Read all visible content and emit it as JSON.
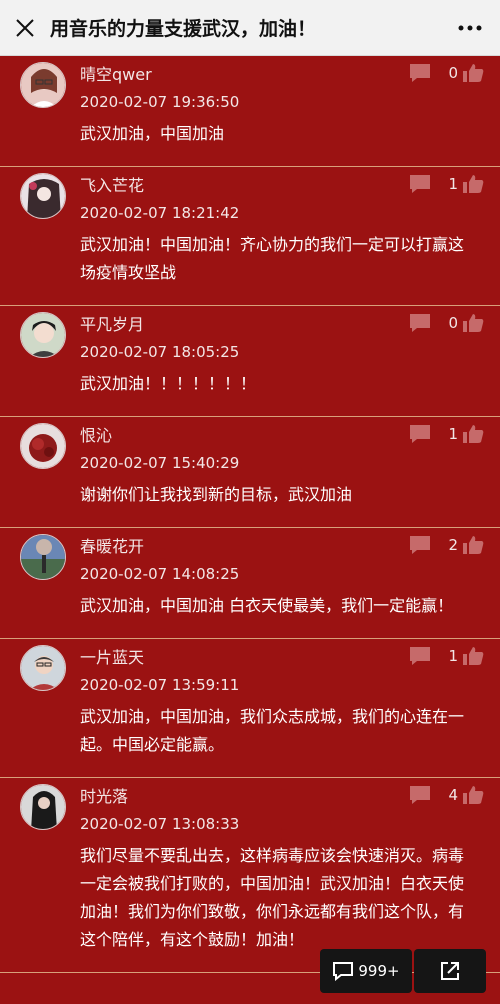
{
  "header": {
    "title": "用音乐的力量支援武汉，加油！"
  },
  "comments": [
    {
      "name": "晴空qwer",
      "time": "2020-02-07 19:36:50",
      "content": "武汉加油，中国加油",
      "likes": "0"
    },
    {
      "name": "飞入芒花",
      "time": "2020-02-07 18:21:42",
      "content": "武汉加油！中国加油！齐心协力的我们一定可以打赢这场疫情攻坚战",
      "likes": "1"
    },
    {
      "name": "平凡岁月",
      "time": "2020-02-07 18:05:25",
      "content": "武汉加油！！！！！！！",
      "likes": "0"
    },
    {
      "name": "恨沁",
      "time": "2020-02-07 15:40:29",
      "content": "谢谢你们让我找到新的目标，武汉加油",
      "likes": "1"
    },
    {
      "name": "春暖花开",
      "time": "2020-02-07 14:08:25",
      "content": "武汉加油，中国加油 白衣天使最美，我们一定能赢！",
      "likes": "2"
    },
    {
      "name": "一片蓝天",
      "time": "2020-02-07 13:59:11",
      "content": "武汉加油，中国加油，我们众志成城，我们的心连在一起。中国必定能赢。",
      "likes": "1"
    },
    {
      "name": "时光落",
      "time": "2020-02-07 13:08:33",
      "content": "我们尽量不要乱出去，这样病毒应该会快速消灭。病毒一定会被我们打败的，中国加油！武汉加油！白衣天使加油！我们为你们致敬，你们永远都有我们这个队，有这个陪伴，有这个鼓励！加油！",
      "likes": "4"
    }
  ],
  "float_bar": {
    "comment_count": "999+"
  },
  "colors": {
    "background": "#9b1212",
    "header": "#f2f2f2",
    "divider": "#d8a07a"
  },
  "icons": [
    "close-icon",
    "more-icon",
    "reply-icon",
    "like-icon",
    "comment-icon",
    "share-icon"
  ]
}
